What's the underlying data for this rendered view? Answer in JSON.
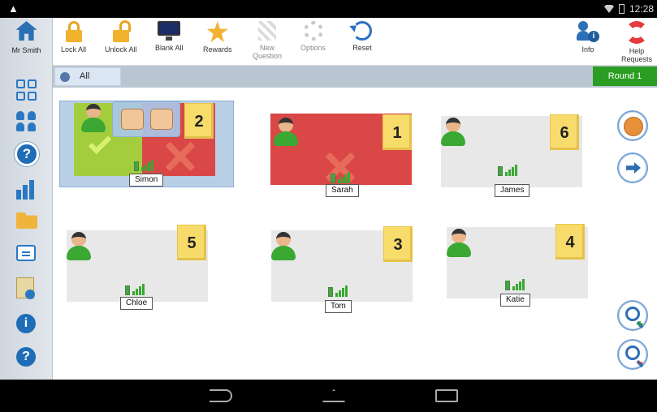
{
  "status": {
    "time": "12:28"
  },
  "teacher": {
    "name": "Mr Smith"
  },
  "toolbar": {
    "lock_all": "Lock All",
    "unlock_all": "Unlock All",
    "blank_all": "Blank All",
    "rewards": "Rewards",
    "new_question": "New Question",
    "options": "Options",
    "reset": "Reset",
    "info": "Info",
    "help_requests": "Help Requests"
  },
  "filter": {
    "all_label": "All",
    "round_label": "Round 1"
  },
  "students": [
    {
      "name": "Simon",
      "number": "2"
    },
    {
      "name": "Sarah",
      "number": "1"
    },
    {
      "name": "James",
      "number": "6"
    },
    {
      "name": "Chloe",
      "number": "5"
    },
    {
      "name": "Tom",
      "number": "3"
    },
    {
      "name": "Katie",
      "number": "4"
    }
  ],
  "colors": {
    "accent_blue": "#2b6fb5",
    "round_green": "#2a9d22",
    "answer_correct": "#a4cd3e",
    "answer_wrong": "#d94747",
    "number_tag": "#f8dc6b"
  },
  "icons": {
    "left_nav": [
      "home-icon",
      "grid-icon",
      "class-icon",
      "help-icon",
      "chart-icon",
      "folder-icon",
      "message-icon",
      "report-icon",
      "info-icon",
      "question-icon"
    ],
    "right_nav": [
      "ball-icon",
      "arrow-icon",
      "zoom-in-icon",
      "zoom-out-icon"
    ]
  }
}
